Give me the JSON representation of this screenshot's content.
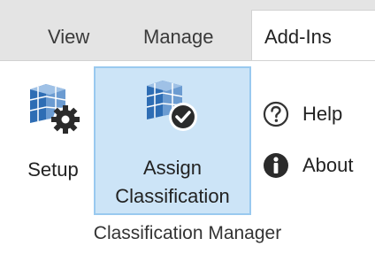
{
  "tabs": [
    {
      "label": "View"
    },
    {
      "label": "Manage"
    },
    {
      "label": "Add-Ins",
      "active": true
    }
  ],
  "panel": {
    "group_label": "Classification Manager",
    "buttons": {
      "setup": {
        "label": "Setup",
        "icon": "building-gear-icon"
      },
      "assign": {
        "label_line1": "Assign",
        "label_line2": "Classification",
        "icon": "building-check-icon",
        "selected": true
      },
      "help": {
        "label": "Help",
        "icon": "question-circle-icon"
      },
      "about": {
        "label": "About",
        "icon": "info-circle-icon"
      }
    }
  },
  "colors": {
    "selected_bg": "#cce4f7",
    "selected_border": "#99c9ef",
    "tab_strip_bg": "#e4e4e4",
    "building_blue": "#2e6db4",
    "building_dark": "#2b2b2b"
  }
}
